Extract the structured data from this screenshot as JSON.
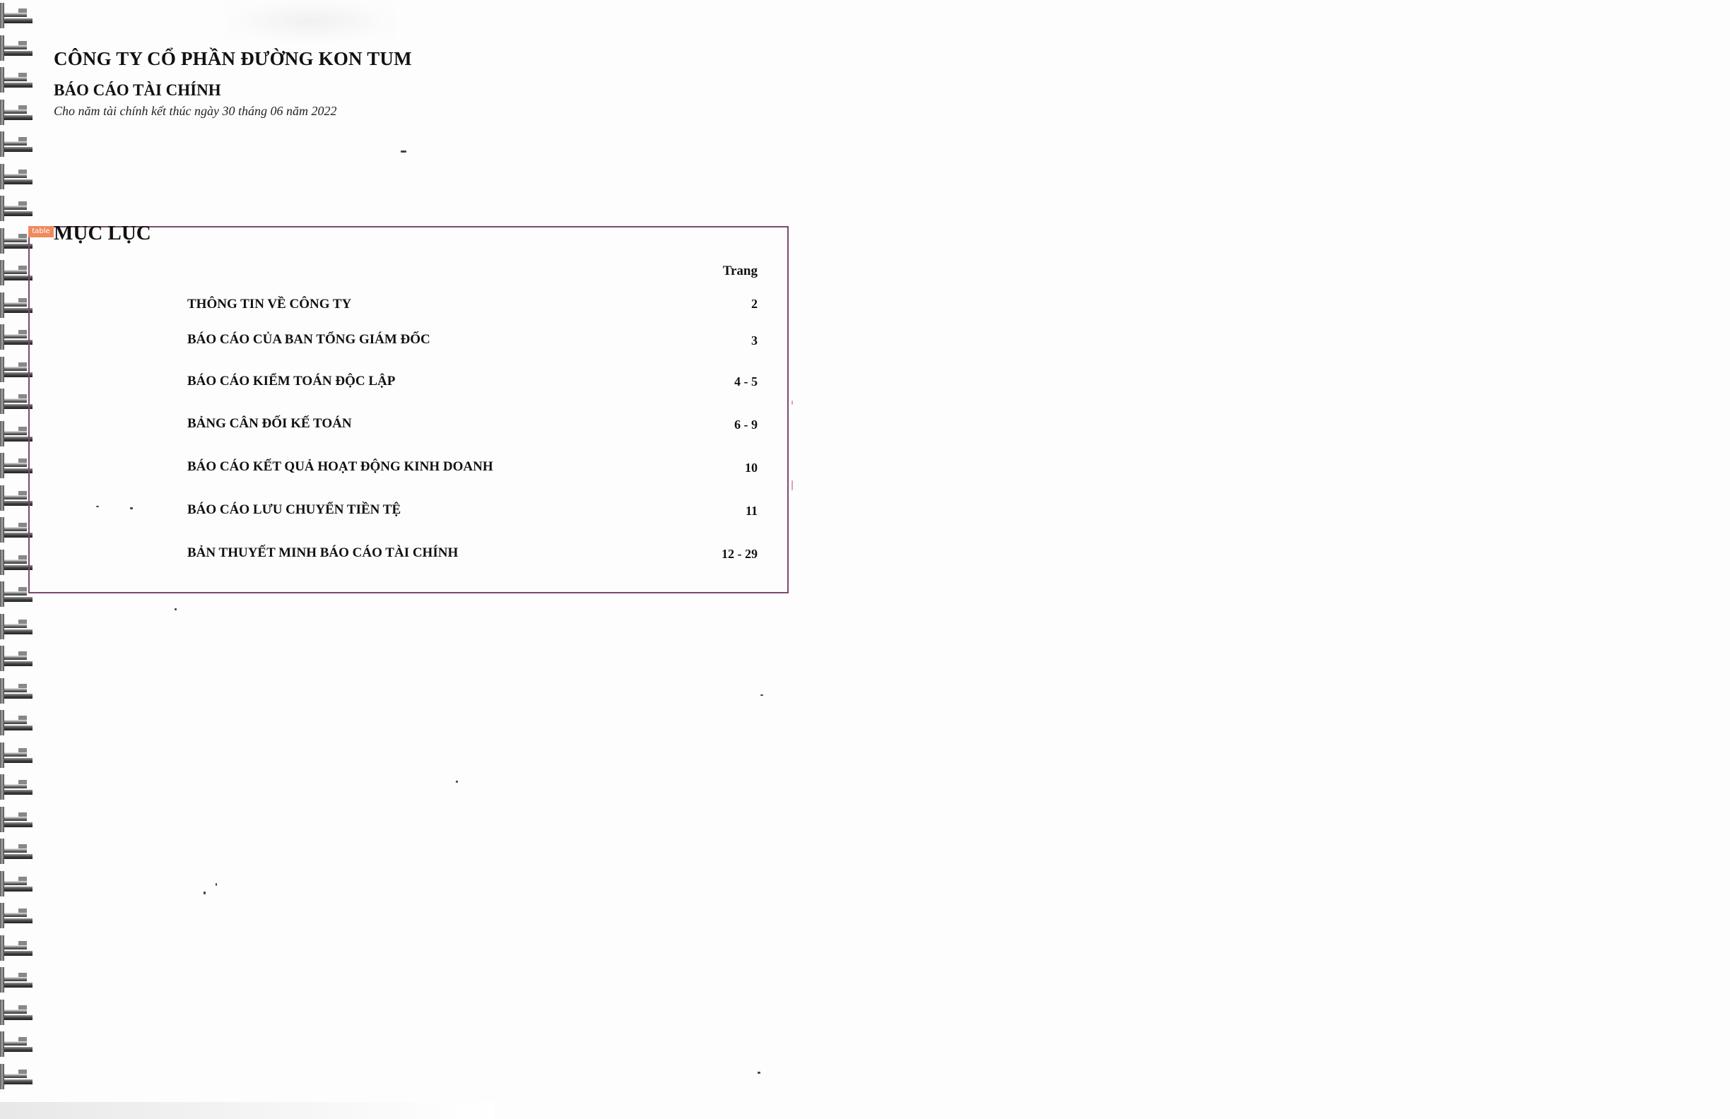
{
  "header": {
    "company_name": "CÔNG TY CỔ PHẦN ĐƯỜNG KON TUM",
    "report_title": "BÁO CÁO TÀI CHÍNH",
    "report_subtitle": "Cho năm tài chính kết thúc ngày 30 tháng 06 năm 2022"
  },
  "toc": {
    "tag": "table",
    "heading": "MỤC LỤC",
    "page_column_label": "Trang",
    "items": [
      {
        "label": "THÔNG TIN VỀ CÔNG TY",
        "page": "2"
      },
      {
        "label": "BÁO CÁO CỦA BAN TỔNG GIÁM ĐỐC",
        "page": "3"
      },
      {
        "label": "BÁO CÁO KIỂM TOÁN ĐỘC LẬP",
        "page": "4 - 5"
      },
      {
        "label": "BẢNG CÂN ĐỐI KẾ TOÁN",
        "page": "6 - 9"
      },
      {
        "label": "BÁO CÁO KẾT QUẢ HOẠT ĐỘNG KINH DOANH",
        "page": "10"
      },
      {
        "label": "BÁO CÁO LƯU CHUYỂN TIỀN TỆ",
        "page": "11"
      },
      {
        "label": "BẢN THUYẾT MINH BÁO CÁO TÀI CHÍNH",
        "page": "12 - 29"
      }
    ]
  },
  "colors": {
    "box_border": "#7a4a6a",
    "tag_badge": "#f08a5d"
  }
}
